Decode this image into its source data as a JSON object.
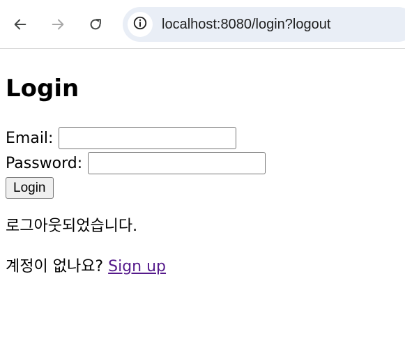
{
  "browser": {
    "url": "localhost:8080/login?logout",
    "icons": {
      "back": "arrow-left-icon",
      "forward": "arrow-right-icon",
      "reload": "reload-icon",
      "site_info": "info-icon"
    }
  },
  "page": {
    "title": "Login",
    "email_label": "Email:",
    "email_value": "",
    "password_label": "Password:",
    "password_value": "",
    "login_button_label": "Login",
    "logout_message": "로그아웃되었습니다.",
    "signup_prompt": "계정이 없나요?",
    "signup_link_label": "Sign up"
  },
  "colors": {
    "link_visited": "#551a8b",
    "omnibox_bg": "#e9eef6"
  }
}
